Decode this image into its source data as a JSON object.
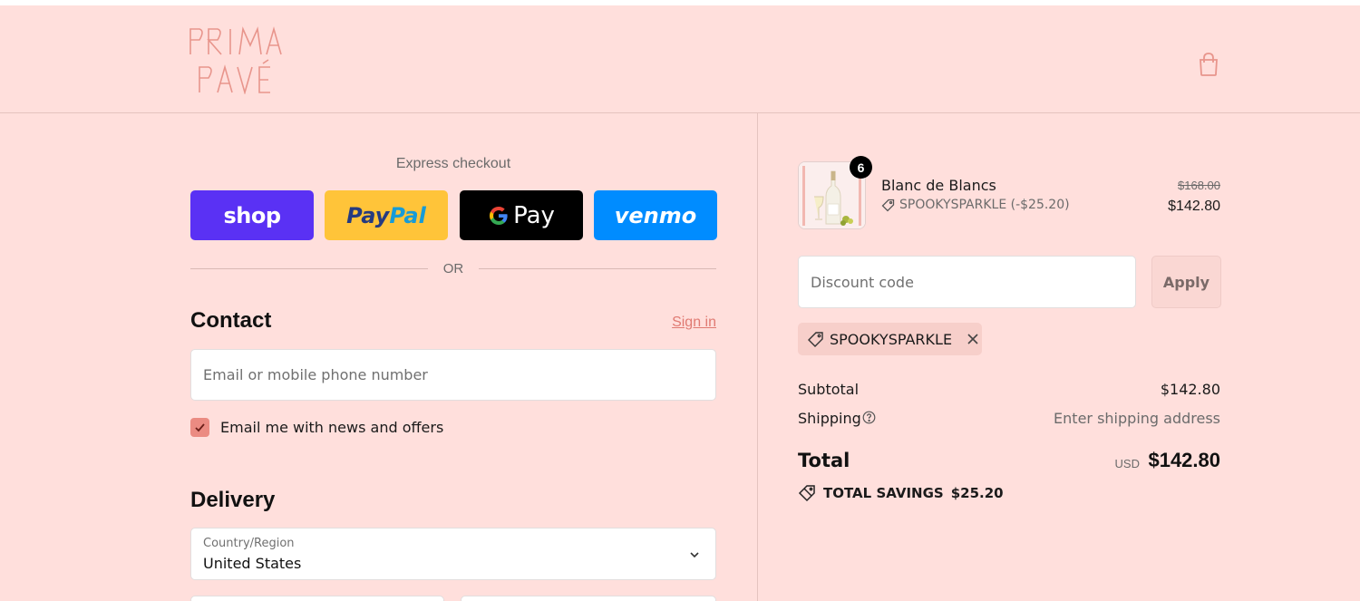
{
  "brand": {
    "logo_alt": "PRIMA PAVÉ",
    "logo_color": "#e8958c"
  },
  "header": {
    "cart_icon": "shopping-bag-icon"
  },
  "express": {
    "title": "Express checkout",
    "buttons": [
      {
        "name": "shop",
        "label": "shop",
        "color": "#5a31f4"
      },
      {
        "name": "paypal",
        "label_a": "Pay",
        "label_b": "Pal",
        "color": "#ffc439"
      },
      {
        "name": "gpay",
        "label": "Pay",
        "color": "#000000"
      },
      {
        "name": "venmo",
        "label": "venmo",
        "color": "#008cff"
      }
    ],
    "or": "OR"
  },
  "contact": {
    "title": "Contact",
    "signin": "Sign in",
    "email_placeholder": "Email or mobile phone number",
    "newsletter_label": "Email me with news and offers",
    "newsletter_checked": true
  },
  "delivery": {
    "title": "Delivery",
    "country_label": "Country/Region",
    "country_value": "United States"
  },
  "summary": {
    "product": {
      "name": "Blanc de Blancs",
      "quantity": "6",
      "discount": "SPOOKYSPARKLE (-$25.20)",
      "price_original": "$168.00",
      "price": "$142.80"
    },
    "discount_placeholder": "Discount code",
    "apply": "Apply",
    "applied_code": "SPOOKYSPARKLE",
    "subtotal_label": "Subtotal",
    "subtotal_value": "$142.80",
    "shipping_label": "Shipping",
    "shipping_value": "Enter shipping address",
    "total_label": "Total",
    "total_currency": "USD",
    "total_value": "$142.80",
    "savings_label": "TOTAL SAVINGS",
    "savings_value": "$25.20"
  },
  "colors": {
    "background": "#ffdfdc",
    "accent": "#eb8b82",
    "link": "#e07a72"
  }
}
